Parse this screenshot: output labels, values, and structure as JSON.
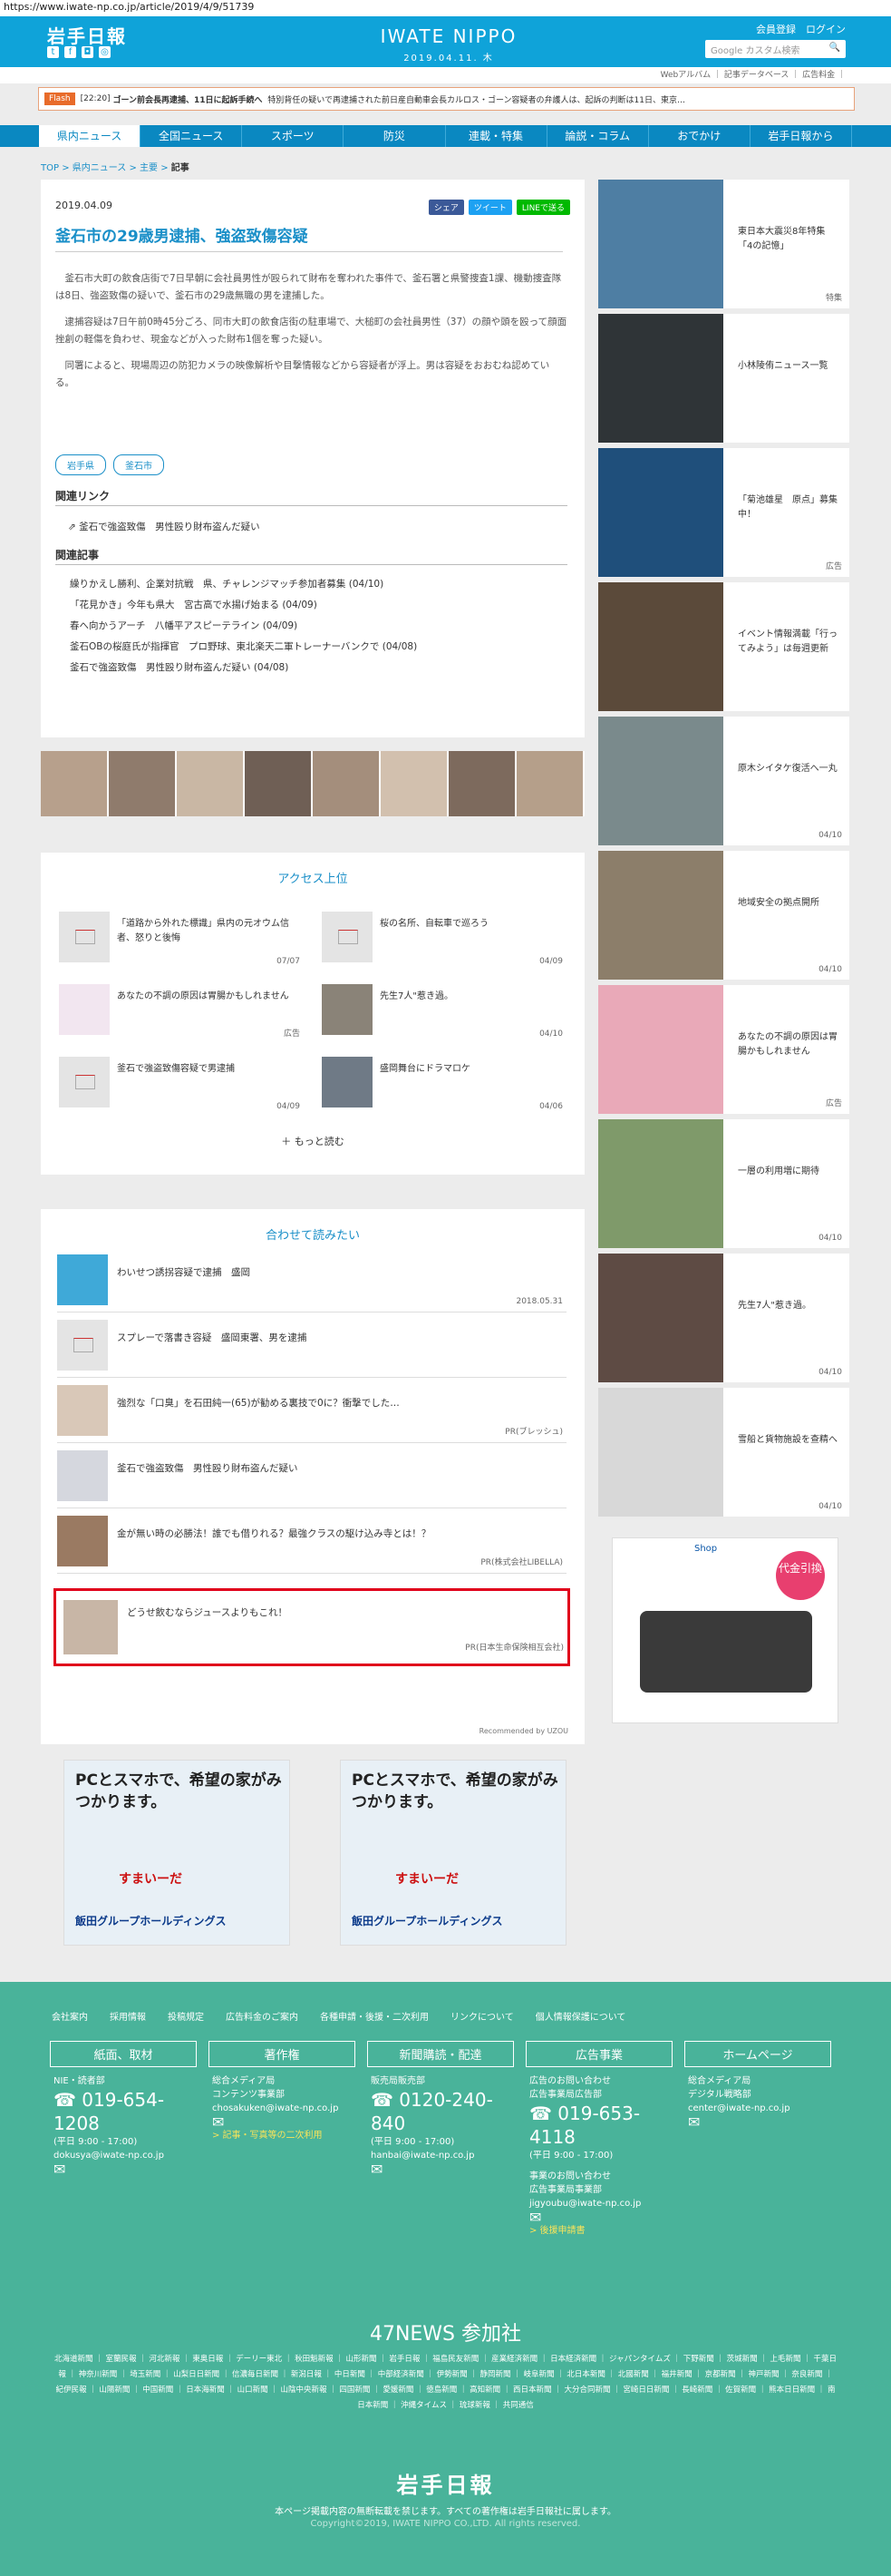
{
  "browser": {
    "url": "https://www.iwate-np.co.jp/article/2019/4/9/51739"
  },
  "header": {
    "logo": "岩手日報",
    "social": [
      "t",
      "f",
      "◘",
      "◎"
    ],
    "site_title": "IWATE NIPPO",
    "site_date": "2019.04.11. 木",
    "member": "会員登録　ログイン",
    "search_placeholder": "Google カスタム検索",
    "subnav": "Webアルバム ｜ 記事データベース ｜ 広告料金 ｜"
  },
  "flash": {
    "label": "Flash",
    "time": "[22:20]",
    "headline": "ゴーン前会長再逮捕、11日に起訴手続へ",
    "text": "特別背任の疑いで再逮捕された前日産自動車会長カルロス・ゴーン容疑者の弁護人は、起訴の判断は11日、東京…"
  },
  "nav": [
    "県内ニュース",
    "全国ニュース",
    "スポーツ",
    "防災",
    "連載・特集",
    "論説・コラム",
    "おでかけ",
    "岩手日報から"
  ],
  "breadcrumb": {
    "top": "TOP",
    "cat": "県内ニュース",
    "sub": "主要",
    "cur": "記事"
  },
  "article": {
    "date": "2019.04.09",
    "share": "シェア",
    "tweet": "ツイート",
    "line": "LINEで送る",
    "title": "釜石市の29歳男逮捕、強盗致傷容疑",
    "p1": "釜石市大町の飲食店街で7日早朝に会社員男性が殴られて財布を奪われた事件で、釜石署と県警捜査1課、機動捜査隊は8日、強盗致傷の疑いで、釜石市の29歳無職の男を逮捕した。",
    "p2": "逮捕容疑は7日午前0時45分ごろ、同市大町の飲食店街の駐車場で、大槌町の会社員男性（37）の顔や頭を殴って顔面挫創の軽傷を負わせ、現金などが入った財布1個を奪った疑い。",
    "p3": "同署によると、現場周辺の防犯カメラの映像解析や目撃情報などから容疑者が浮上。男は容疑をおおむね認めている。",
    "tags": [
      "岩手県",
      "釜石市"
    ],
    "rel_link_h": "関連リンク",
    "rel_link": "釜石で強盗致傷　男性殴り財布盗んだ疑い",
    "rel_h": "関連記事",
    "related": [
      "繰りかえし勝利、企業対抗戦　県、チャレンジマッチ参加者募集 (04/10)",
      "「花見かき」今年も県大　宮古高で水揚げ始まる (04/09)",
      "春へ向かうアーチ　八幡平アスピーテライン (04/09)",
      "釜石OBの桜庭氏が指揮官　プロ野球、東北楽天二軍トレーナーバンクで (04/08)",
      "釜石で強盗致傷　男性殴り財布盗んだ疑い (04/08)"
    ]
  },
  "access": {
    "title": "アクセス上位",
    "items": [
      {
        "t": "「道路から外れた標識」県内の元オウム信者、怒りと後悔",
        "d": "07/07"
      },
      {
        "t": "桜の名所、自転車で巡ろう",
        "d": "04/09"
      },
      {
        "t": "あなたの不調の原因は胃腸かもしれません",
        "d": "広告"
      },
      {
        "t": "先生7人\"惹き過。",
        "d": "04/10"
      },
      {
        "t": "釜石で強盗致傷容疑で男逮捕",
        "d": "04/09"
      },
      {
        "t": "盛岡舞台にドラマロケ",
        "d": "04/06"
      }
    ],
    "more": "もっと読む"
  },
  "recommend": {
    "title": "合わせて読みたい",
    "items": [
      {
        "t": "わいせつ誘拐容疑で逮捕　盛岡",
        "d": "2018.05.31"
      },
      {
        "t": "スプレーで落書き容疑　盛岡東署、男を逮捕",
        "d": ""
      },
      {
        "t": "強烈な「口臭」を石田純一(65)が勧める裏技で0に？衝撃でした…",
        "d": "PR(ブレッシュ)"
      },
      {
        "t": "釜石で強盗致傷　男性殴り財布盗んだ疑い",
        "d": ""
      },
      {
        "t": "金が無い時の必勝法！誰でも借りれる？最強クラスの駆け込み寺とは！？",
        "d": "PR(株式会社LIBELLA)"
      },
      {
        "t": "どうせ飲むならジュースよりもこれ！",
        "d": "PR(日本生命保険相互会社)"
      }
    ],
    "uzou": "Recommended by UZOU"
  },
  "ads": [
    {
      "h": "PCとスマホで、希望の家がみつかります。",
      "brand": "すまいーだ",
      "logo": "飯田グループホールディングス"
    },
    {
      "h": "PCとスマホで、希望の家がみつかります。",
      "brand": "すまいーだ",
      "logo": "飯田グループホールディングス"
    }
  ],
  "sidebar": [
    {
      "t": "東日本大震災8年特集「4の記憶」",
      "d": "特集"
    },
    {
      "t": "小林陵侑ニュース一覧",
      "d": ""
    },
    {
      "t": "「菊池雄星　原点」募集中！",
      "d": "広告"
    },
    {
      "t": "イベント情報満載「行ってみよう」は毎週更新",
      "d": ""
    },
    {
      "t": "原木シイタケ復活へ一丸",
      "d": "04/10"
    },
    {
      "t": "地域安全の拠点開所",
      "d": "04/10"
    },
    {
      "t": "あなたの不調の原因は胃腸かもしれません",
      "d": "広告"
    },
    {
      "t": "一層の利用増に期待",
      "d": "04/10"
    },
    {
      "t": "先生7人\"惹き過。",
      "d": "04/10"
    },
    {
      "t": "雪船と貨物施設を查精へ",
      "d": "04/10"
    }
  ],
  "sidead": {
    "shop": "Shop",
    "badge": "代金引換"
  },
  "footer": {
    "links": [
      "会社案内",
      "採用情報",
      "投稿規定",
      "広告料金のご案内",
      "各種申請・後援・二次利用",
      "リンクについて",
      "個人情報保護について"
    ],
    "cols": [
      {
        "hd": "紙面、取材",
        "l1": "NIE・読者部",
        "tel": "019-654-1208",
        "hours": "(平日 9:00 - 17:00)",
        "mail": "dokusya@iwate-np.co.jp",
        "extra": ""
      },
      {
        "hd": "著作権",
        "l1": "総合メディア局",
        "l2": "コンテンツ事業部",
        "mail": "chosakuken@iwate-np.co.jp",
        "extra": "> 記事・写真等の二次利用"
      },
      {
        "hd": "新聞購読・配達",
        "l1": "販売局販売部",
        "tel": "0120-240-840",
        "hours": "(平日 9:00 - 17:00)",
        "mail": "hanbai@iwate-np.co.jp"
      },
      {
        "hd": "広告事業",
        "l1": "広告のお問い合わせ",
        "l2": "広告事業局広告部",
        "tel": "019-653-4118",
        "hours": "(平日 9:00 - 17:00)",
        "l3": "事業のお問い合わせ",
        "l4": "広告事業局事業部",
        "mail": "jigyoubu@iwate-np.co.jp",
        "extra": "> 後援申請書"
      },
      {
        "hd": "ホームページ",
        "l1": "総合メディア局",
        "l2": "デジタル戦略部",
        "mail": "center@iwate-np.co.jp"
      }
    ],
    "news47": "47NEWS 参加社",
    "papers": "北海道新聞 ｜ 室蘭民報 ｜ 河北新報 ｜ 東奥日報 ｜ デーリー東北 ｜ 秋田魁新報 ｜ 山形新聞 ｜ 岩手日報 ｜ 福島民友新聞 ｜ 産業経済新聞 ｜ 日本経済新聞 ｜ ジャパンタイムズ ｜ 下野新聞 ｜ 茨城新聞 ｜ 上毛新聞 ｜ 千葉日報 ｜ 神奈川新聞 ｜ 埼玉新聞 ｜ 山梨日日新聞 ｜ 信濃毎日新聞 ｜ 新潟日報 ｜ 中日新聞 ｜ 中部経済新聞 ｜ 伊勢新聞 ｜ 静岡新聞 ｜ 岐阜新聞 ｜ 北日本新聞 ｜ 北國新聞 ｜ 福井新聞 ｜ 京都新聞 ｜ 神戸新聞 ｜ 奈良新聞 ｜ 紀伊民報 ｜ 山陽新聞 ｜ 中国新聞 ｜ 日本海新聞 ｜ 山口新聞 ｜ 山陰中央新報 ｜ 四国新聞 ｜ 愛媛新聞 ｜ 徳島新聞 ｜ 高知新聞 ｜ 西日本新聞 ｜ 大分合同新聞 ｜ 宮崎日日新聞 ｜ 長崎新聞 ｜ 佐賀新聞 ｜ 熊本日日新聞 ｜ 南日本新聞 ｜ 沖縄タイムス ｜ 琉球新報 ｜ 共同通信",
    "logo": "岩手日報",
    "note": "本ページ掲載内容の無断転載を禁じます。すべての著作権は岩手日報社に属します。",
    "copy": "Copyright©2019, IWATE NIPPO CO.,LTD. All rights reserved."
  }
}
